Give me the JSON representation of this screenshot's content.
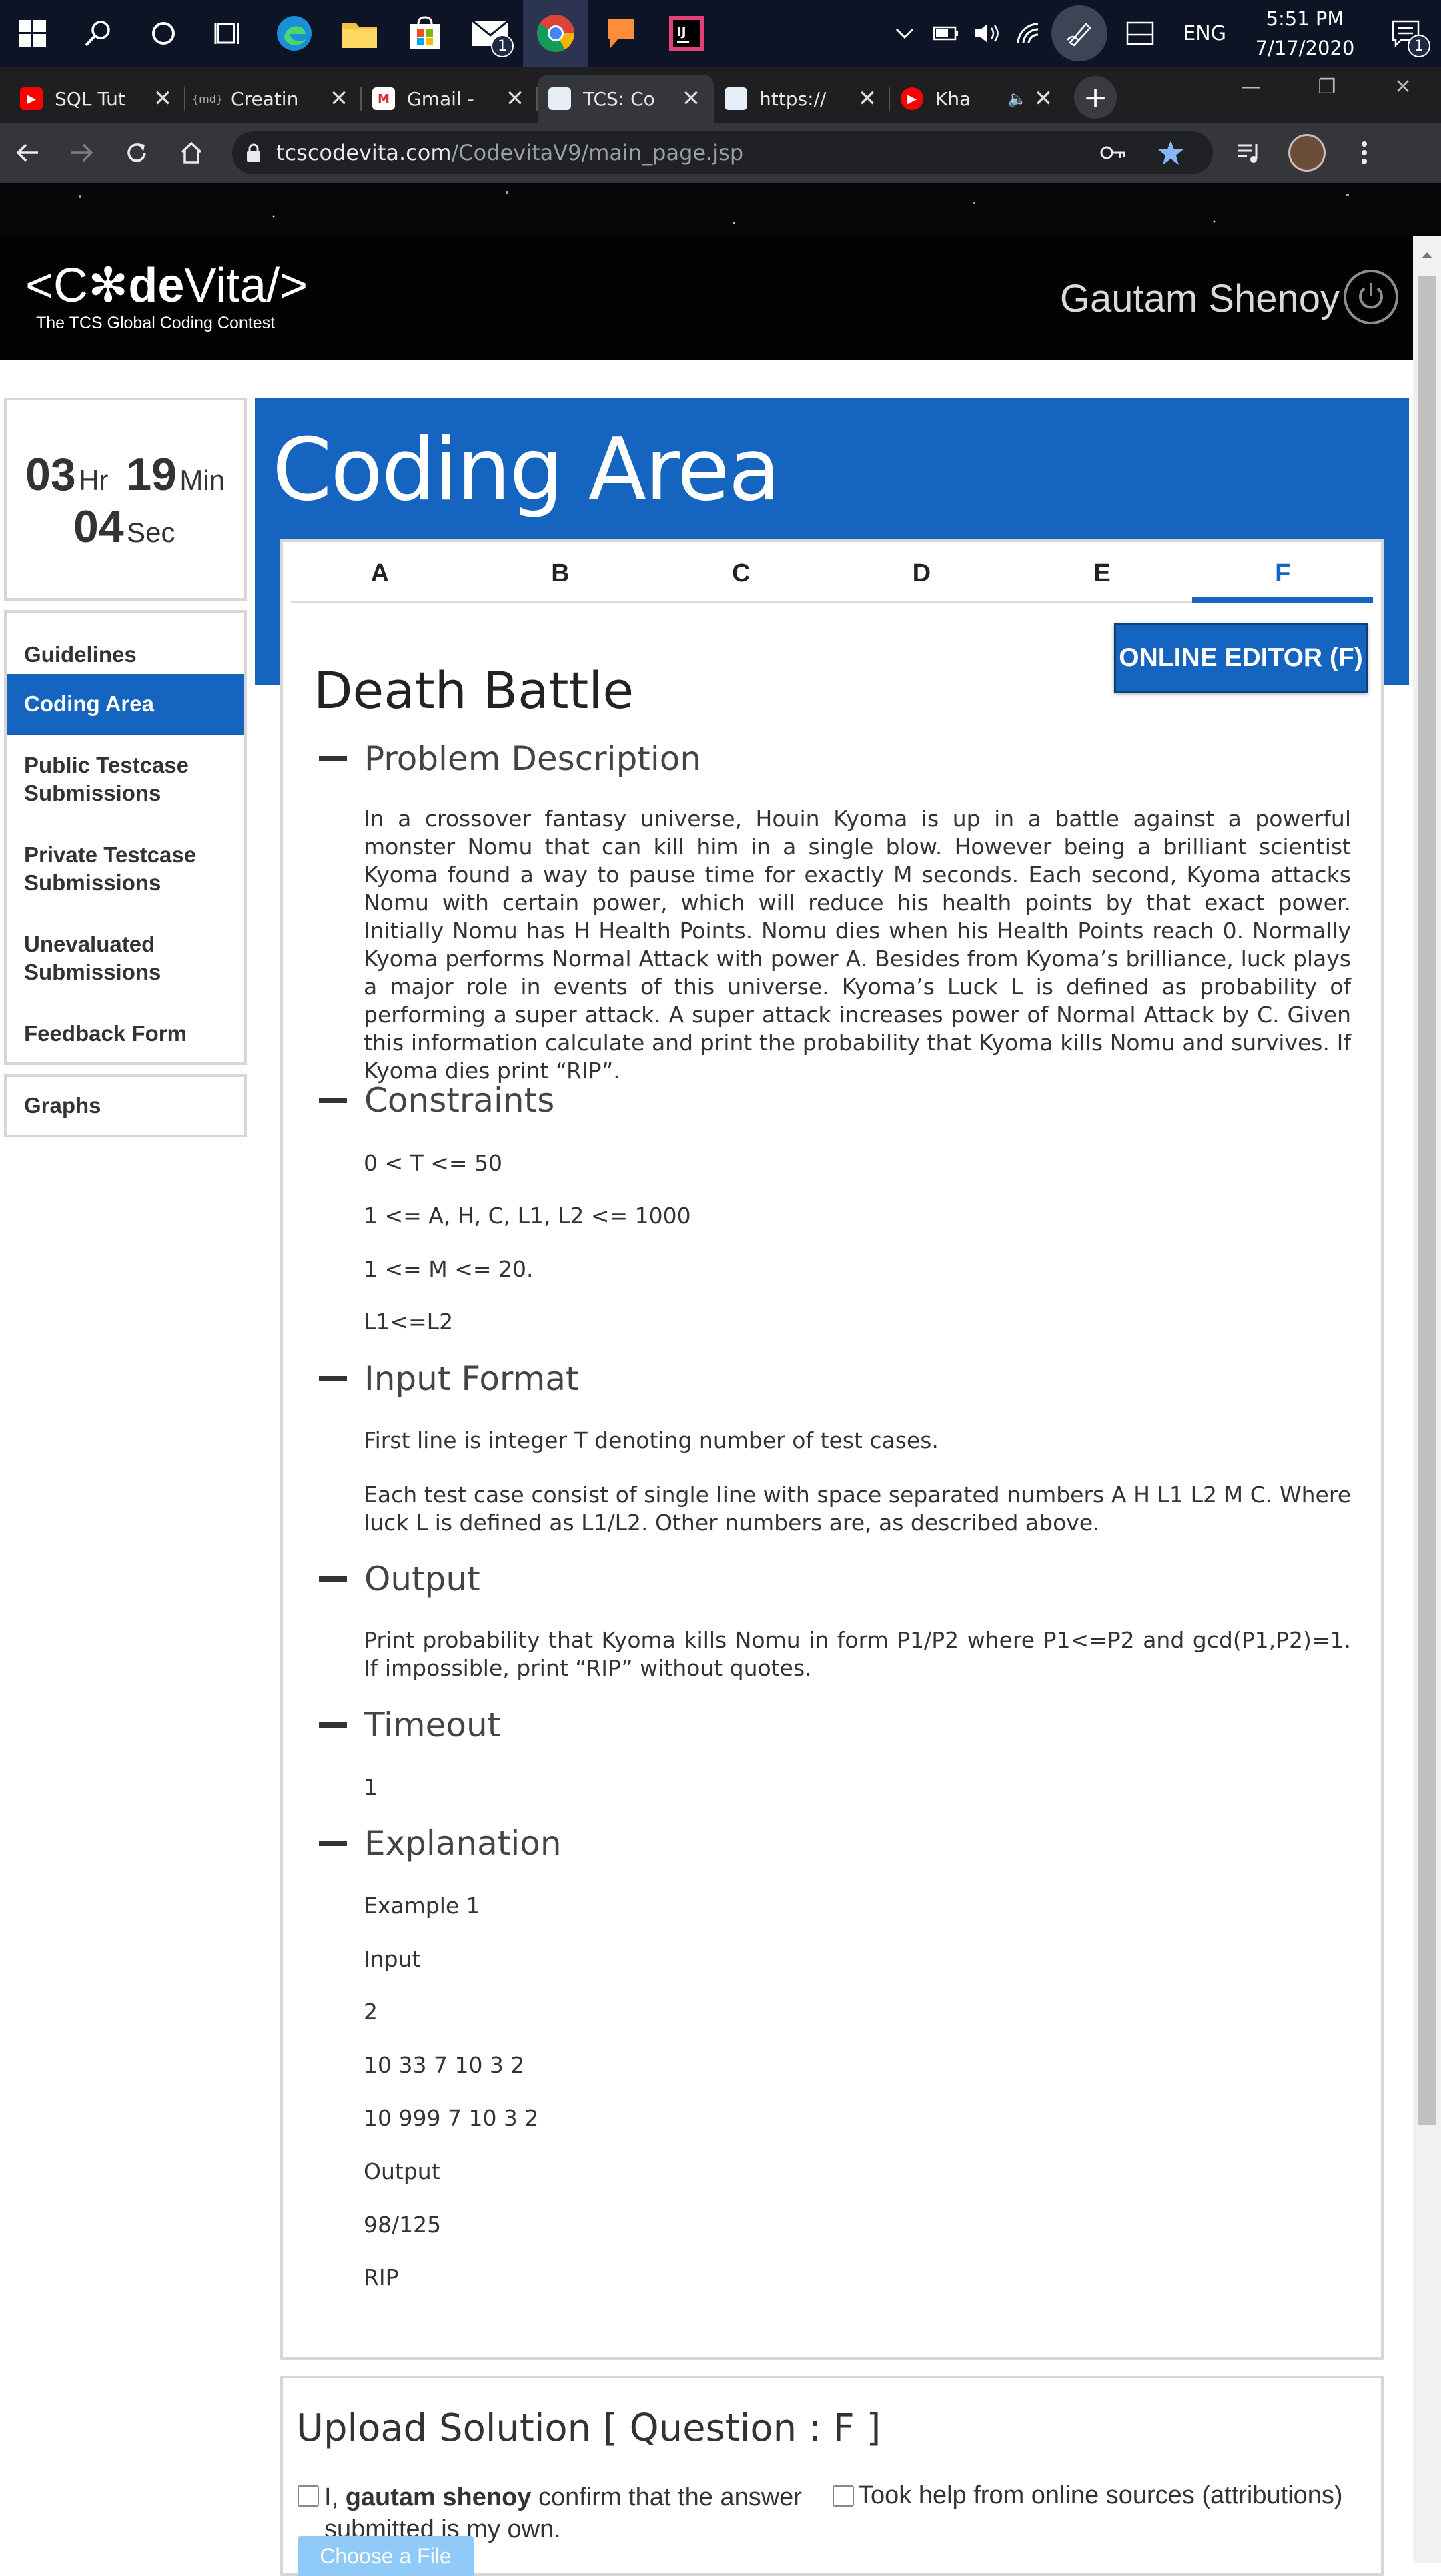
{
  "taskbar": {
    "icons": [
      "windows-start-icon",
      "search-icon",
      "cortana-icon",
      "task-view-icon",
      "edge-icon",
      "file-explorer-icon",
      "store-icon",
      "mail-icon",
      "chrome-icon",
      "feedback-icon",
      "intellij-icon"
    ],
    "mail_badge": "1",
    "language": "ENG",
    "time": "5:51 PM",
    "date": "7/17/2020",
    "notification_badge": "1"
  },
  "browser": {
    "tabs": [
      {
        "title": "SQL Tut",
        "favicon_color": "#ff0000",
        "favicon": "▶"
      },
      {
        "title": "Creatin",
        "favicon_color": "#1f1f22",
        "favicon": "{md}"
      },
      {
        "title": "Gmail -",
        "favicon_color": "#ffffff",
        "favicon": "M"
      },
      {
        "title": "TCS: Co",
        "favicon_color": "#e6eef7",
        "favicon": ""
      },
      {
        "title": "https://",
        "favicon_color": "#e6eef7",
        "favicon": ""
      },
      {
        "title": "Kha",
        "favicon_color": "#ff0000",
        "favicon": "▶"
      }
    ],
    "active_tab": 3,
    "new_tab_label": "+",
    "url_host": "tcscodevita.com",
    "url_path": "/CodevitaV9/main_page.jsp"
  },
  "site": {
    "logo_prefix": "<C",
    "logo_star": "✻",
    "logo_de": "de",
    "logo_suffix": "Vita/>",
    "tagline": "The TCS Global Coding Contest",
    "username": "Gautam Shenoy"
  },
  "timer": {
    "hours": "03",
    "hours_unit": "Hr",
    "minutes": "19",
    "minutes_unit": "Min",
    "seconds": "04",
    "seconds_unit": "Sec"
  },
  "sidebar": {
    "items": [
      "Guidelines",
      "Coding Area",
      "Public Testcase Submissions",
      "Private Testcase Submissions",
      "Unevaluated Submissions",
      "Feedback Form"
    ],
    "active": "Coding Area",
    "graphs": "Graphs"
  },
  "main": {
    "title": "Coding Area",
    "question_tabs": [
      "A",
      "B",
      "C",
      "D",
      "E",
      "F"
    ],
    "active_question": "F",
    "editor_button": "ONLINE EDITOR (F)",
    "problem_title": "Death Battle",
    "sections": {
      "description_head": "Problem Description",
      "description": "In a crossover fantasy universe, Houin Kyoma is up in a battle against a powerful monster Nomu that can kill him in a single blow. However being a brilliant scientist Kyoma found a way to pause time for exactly M seconds. Each second, Kyoma attacks Nomu with certain power, which will reduce his health points by that exact power. Initially Nomu has H Health Points. Nomu dies when his Health Points reach 0. Normally Kyoma performs Normal Attack with power A. Besides from Kyoma’s brilliance, luck plays a major role in events of this universe. Kyoma’s Luck L is defined as probability of performing a super attack. A super attack increases power of Normal Attack by C. Given this information calculate and print the probability that Kyoma kills Nomu and survives. If Kyoma dies print “RIP”.",
      "constraints_head": "Constraints",
      "constraints": [
        "0 < T <= 50",
        "1 <= A, H, C, L1, L2 <= 1000",
        "1 <= M <= 20.",
        "L1<=L2"
      ],
      "input_head": "Input Format",
      "input_line1": "First line is integer T denoting number of test cases.",
      "input_line2": "Each test case consist of single line with space separated numbers A H L1 L2 M C. Where luck L is defined as L1/L2. Other numbers are, as described above.",
      "output_head": "Output",
      "output": "Print probability that Kyoma kills Nomu in form P1/P2 where P1<=P2 and gcd(P1,P2)=1. If impossible, print “RIP” without quotes.",
      "timeout_head": "Timeout",
      "timeout": "1",
      "explanation_head": "Explanation",
      "explanation": [
        "Example 1",
        "Input",
        "2",
        "10 33 7 10 3 2",
        "10 999 7 10 3 2",
        "Output",
        "98/125",
        "RIP"
      ]
    }
  },
  "upload": {
    "title": "Upload Solution [ Question : F ]",
    "confirm_prefix": "I, ",
    "confirm_name": "gautam shenoy",
    "confirm_suffix": " confirm that the answer submitted is my own.",
    "help_label": "Took help from online sources (attributions)",
    "choose_file": "Choose a File"
  },
  "colors": {
    "accent": "#1565c0",
    "header_bg": "#020202",
    "taskbar_bg": "#0d1426"
  }
}
